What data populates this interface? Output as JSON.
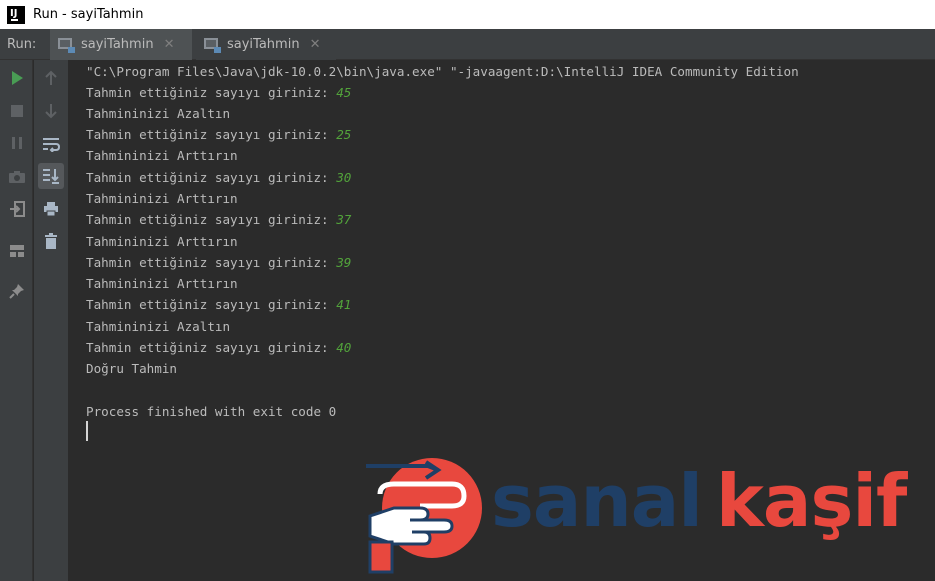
{
  "window": {
    "title": "Run - sayiTahmin",
    "app_icon_text": "IJ"
  },
  "run_panel": {
    "label": "Run:",
    "tabs": [
      {
        "label": "sayiTahmin",
        "close": "✕"
      },
      {
        "label": "sayiTahmin",
        "close": "✕"
      }
    ]
  },
  "icons": {
    "left_toolbar": [
      "rerun-icon",
      "stop-icon",
      "pause-icon",
      "camera-icon",
      "exit-icon",
      "layout-icon",
      "pin-icon"
    ],
    "right_toolbar": [
      "up-arrow-icon",
      "down-arrow-icon",
      "soft-wrap-icon",
      "scroll-to-end-icon",
      "print-icon",
      "trash-icon"
    ]
  },
  "colors": {
    "run_green": "#499c54",
    "user_input": "#52a33b",
    "watermark_dark": "#1f3f66",
    "watermark_red": "#e8483e"
  },
  "console": {
    "command": "\"C:\\Program Files\\Java\\jdk-10.0.2\\bin\\java.exe\" \"-javaagent:D:\\IntelliJ IDEA Community Edition",
    "lines": [
      {
        "text": "Tahmin ettiğiniz sayıyı giriniz: ",
        "input": "45"
      },
      {
        "text": "Tahmininizi Azaltın",
        "input": ""
      },
      {
        "text": "Tahmin ettiğiniz sayıyı giriniz: ",
        "input": "25"
      },
      {
        "text": "Tahmininizi Arttırın",
        "input": ""
      },
      {
        "text": "Tahmin ettiğiniz sayıyı giriniz: ",
        "input": "30"
      },
      {
        "text": "Tahmininizi Arttırın",
        "input": ""
      },
      {
        "text": "Tahmin ettiğiniz sayıyı giriniz: ",
        "input": "37"
      },
      {
        "text": "Tahmininizi Arttırın",
        "input": ""
      },
      {
        "text": "Tahmin ettiğiniz sayıyı giriniz: ",
        "input": "39"
      },
      {
        "text": "Tahmininizi Arttırın",
        "input": ""
      },
      {
        "text": "Tahmin ettiğiniz sayıyı giriniz: ",
        "input": "41"
      },
      {
        "text": "Tahmininizi Azaltın",
        "input": ""
      },
      {
        "text": "Tahmin ettiğiniz sayıyı giriniz: ",
        "input": "40"
      },
      {
        "text": "Doğru Tahmin",
        "input": ""
      }
    ],
    "exit_message": "Process finished with exit code 0"
  },
  "watermark": {
    "part1": "sanal",
    "part2": "kaşif"
  }
}
